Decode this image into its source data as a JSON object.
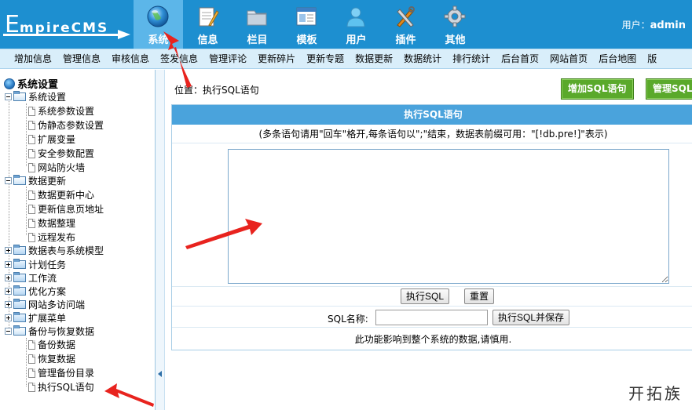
{
  "logo": {
    "first_letter": "E",
    "rest": "mpireCMS"
  },
  "topnav": [
    {
      "label": "系统",
      "icon": "globe-icon",
      "active": true
    },
    {
      "label": "信息",
      "icon": "notepad-icon"
    },
    {
      "label": "栏目",
      "icon": "folder-icon"
    },
    {
      "label": "模板",
      "icon": "window-icon"
    },
    {
      "label": "用户",
      "icon": "user-icon"
    },
    {
      "label": "插件",
      "icon": "tools-icon"
    },
    {
      "label": "其他",
      "icon": "gear-icon"
    }
  ],
  "user": {
    "label": "用户：",
    "name": "admin"
  },
  "subnav": [
    "增加信息",
    "管理信息",
    "审核信息",
    "签发信息",
    "管理评论",
    "更新碎片",
    "更新专题",
    "数据更新",
    "数据统计",
    "排行统计",
    "后台首页",
    "网站首页",
    "后台地图",
    "版"
  ],
  "tree": {
    "title": "系统设置",
    "groups": [
      {
        "label": "系统设置",
        "open": true,
        "children": [
          "系统参数设置",
          "伪静态参数设置",
          "扩展变量",
          "安全参数配置",
          "网站防火墙"
        ]
      },
      {
        "label": "数据更新",
        "open": true,
        "children": [
          "数据更新中心",
          "更新信息页地址",
          "数据整理",
          "远程发布"
        ]
      },
      {
        "label": "数据表与系统模型",
        "open": false
      },
      {
        "label": "计划任务",
        "open": false
      },
      {
        "label": "工作流",
        "open": false
      },
      {
        "label": "优化方案",
        "open": false
      },
      {
        "label": "网站多访问端",
        "open": false
      },
      {
        "label": "扩展菜单",
        "open": false
      },
      {
        "label": "备份与恢复数据",
        "open": true,
        "children": [
          "备份数据",
          "恢复数据",
          "管理备份目录",
          "执行SQL语句"
        ]
      }
    ]
  },
  "main": {
    "location_label": "位置：",
    "location_value": "执行SQL语句",
    "add_sql_button": "增加SQL语句",
    "manage_sql_button": "管理SQL",
    "panel_title": "执行SQL语句",
    "hint": "(多条语句请用\"回车\"格开,每条语句以\";\"结束，数据表前缀可用：\"[!db.pre!]\"表示)",
    "sql_textarea_value": "",
    "execute_button": "执行SQL",
    "reset_button": "重置",
    "sql_name_label": "SQL名称:",
    "sql_name_value": "",
    "execute_save_button": "执行SQL并保存",
    "warning": "此功能影响到整个系统的数据,请慎用."
  },
  "watermark": "开拓族",
  "colors": {
    "header": "#1d8fd0",
    "active_tab": "#5cb6e9",
    "subnav": "#d9eefa",
    "panel_head": "#4aa3dc",
    "green_button": "#5aa92b",
    "annotation_arrow": "#e8231e"
  }
}
